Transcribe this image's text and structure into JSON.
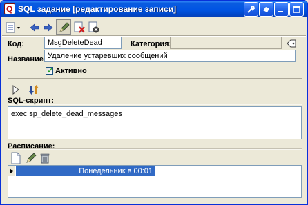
{
  "window": {
    "title": "SQL задание [редактирование записи]",
    "icon_text": "Q"
  },
  "titlebar_buttons": [
    "tools-icon",
    "help-icon",
    "minimize-icon",
    "maximize-icon",
    "close-icon"
  ],
  "toolbar": {
    "items": [
      "records-menu-icon",
      "back-arrow-icon",
      "forward-arrow-icon",
      "edit-pen-icon",
      "delete-doc-icon",
      "close-doc-icon"
    ]
  },
  "form": {
    "code_label": "Код:",
    "code_value": "MsgDeleteDead",
    "category_label": "Категория:",
    "category_value": "",
    "name_label": "Название:",
    "name_value": "Удаление устаревших сообщений",
    "active_label": "Активно",
    "active_checked": true
  },
  "actions": [
    "run-icon",
    "import-icon"
  ],
  "sql": {
    "label": "SQL-скрипт:",
    "text": "exec sp_delete_dead_messages"
  },
  "schedule": {
    "label": "Расписание:",
    "rows": [
      "Понедельник в 00:01"
    ]
  },
  "colors": {
    "title_blue": "#0054e3",
    "selection": "#316ac5",
    "background": "#ece9d8"
  }
}
